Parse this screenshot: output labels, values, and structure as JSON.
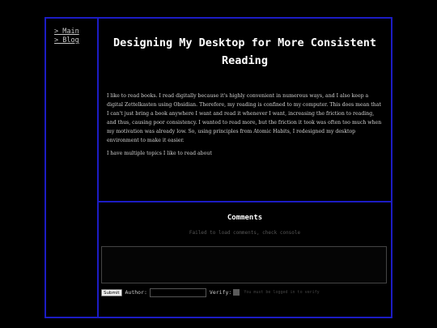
{
  "nav": {
    "items": [
      {
        "label": "> Main"
      },
      {
        "label": "> Blog"
      }
    ]
  },
  "article": {
    "title": "Designing My Desktop for More Consistent Reading",
    "paragraphs": [
      "I like to read books. I read digitally because it's highly convenient in numerous ways, and I also keep a digital Zettelkasten using Obsidian. Therefore, my reading is confined to my computer. This does mean that I can't just bring a book anywhere I want and read it whenever I want, increasing the friction to reading, and thus, causing poor consistency. I wanted to read more, but the friction it took was often too much when my motivation was already low. So, using principles from Atomic Habits, I redesigned my desktop environment to make it easier.",
      "I have multiple topics I like to read about"
    ]
  },
  "comments": {
    "title": "Comments",
    "status": "Failed to load comments, check console",
    "comment_value": "",
    "submit_label": "Submit",
    "author_label": "Author:",
    "author_value": "",
    "verify_label": "Verify:",
    "verify_note": "You must be logged in to verify"
  },
  "colors": {
    "background": "#000000",
    "border": "#1c1cc4",
    "text": "#d0d0d0"
  }
}
